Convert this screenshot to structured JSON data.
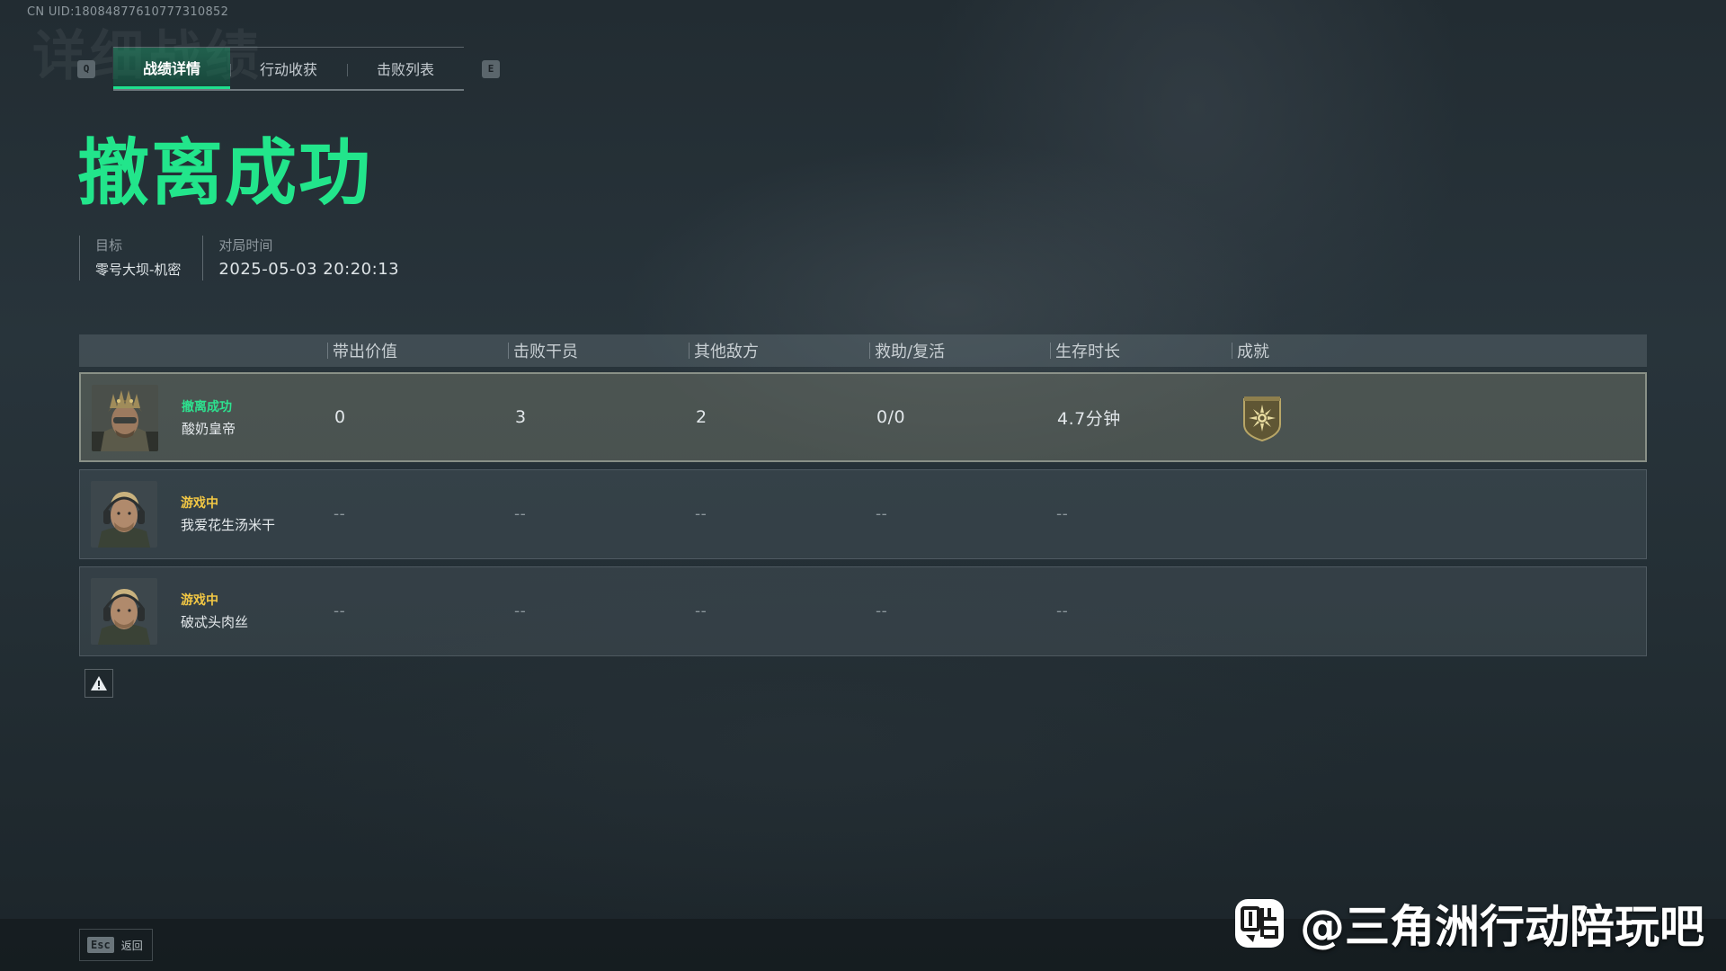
{
  "uid_text": "CN UID:18084877610777310852",
  "background_title": "详细战绩",
  "tabs": {
    "left_key": "Q",
    "right_key": "E",
    "items": [
      {
        "label": "战绩详情",
        "active": true
      },
      {
        "label": "行动收获",
        "active": false
      },
      {
        "label": "击败列表",
        "active": false
      }
    ]
  },
  "result_title": "撤离成功",
  "meta": {
    "target_label": "目标",
    "target_value": "零号大坝-机密",
    "time_label": "对局时间",
    "time_value": "2025-05-03 20:20:13"
  },
  "table": {
    "headers": [
      "带出价值",
      "击败干员",
      "其他敌方",
      "救助/复活",
      "生存时长",
      "成就"
    ],
    "rows": [
      {
        "status": "撤离成功",
        "status_type": "success",
        "name": "酸奶皇帝",
        "values": [
          "0",
          "3",
          "2",
          "0/0",
          "4.7分钟"
        ],
        "achievement": "sun-emblem-badge-icon"
      },
      {
        "status": "游戏中",
        "status_type": "playing",
        "name": "我爱花生汤米干",
        "values": [
          "--",
          "--",
          "--",
          "--",
          "--"
        ]
      },
      {
        "status": "游戏中",
        "status_type": "playing",
        "name": "破忒头肉丝",
        "values": [
          "--",
          "--",
          "--",
          "--",
          "--"
        ]
      }
    ]
  },
  "footer": {
    "esc_key": "Esc",
    "esc_label": "返回"
  },
  "watermark": "@三角洲行动陪玩吧",
  "colors": {
    "accent_green": "#22e58b",
    "playing_yellow": "#f2c744"
  }
}
